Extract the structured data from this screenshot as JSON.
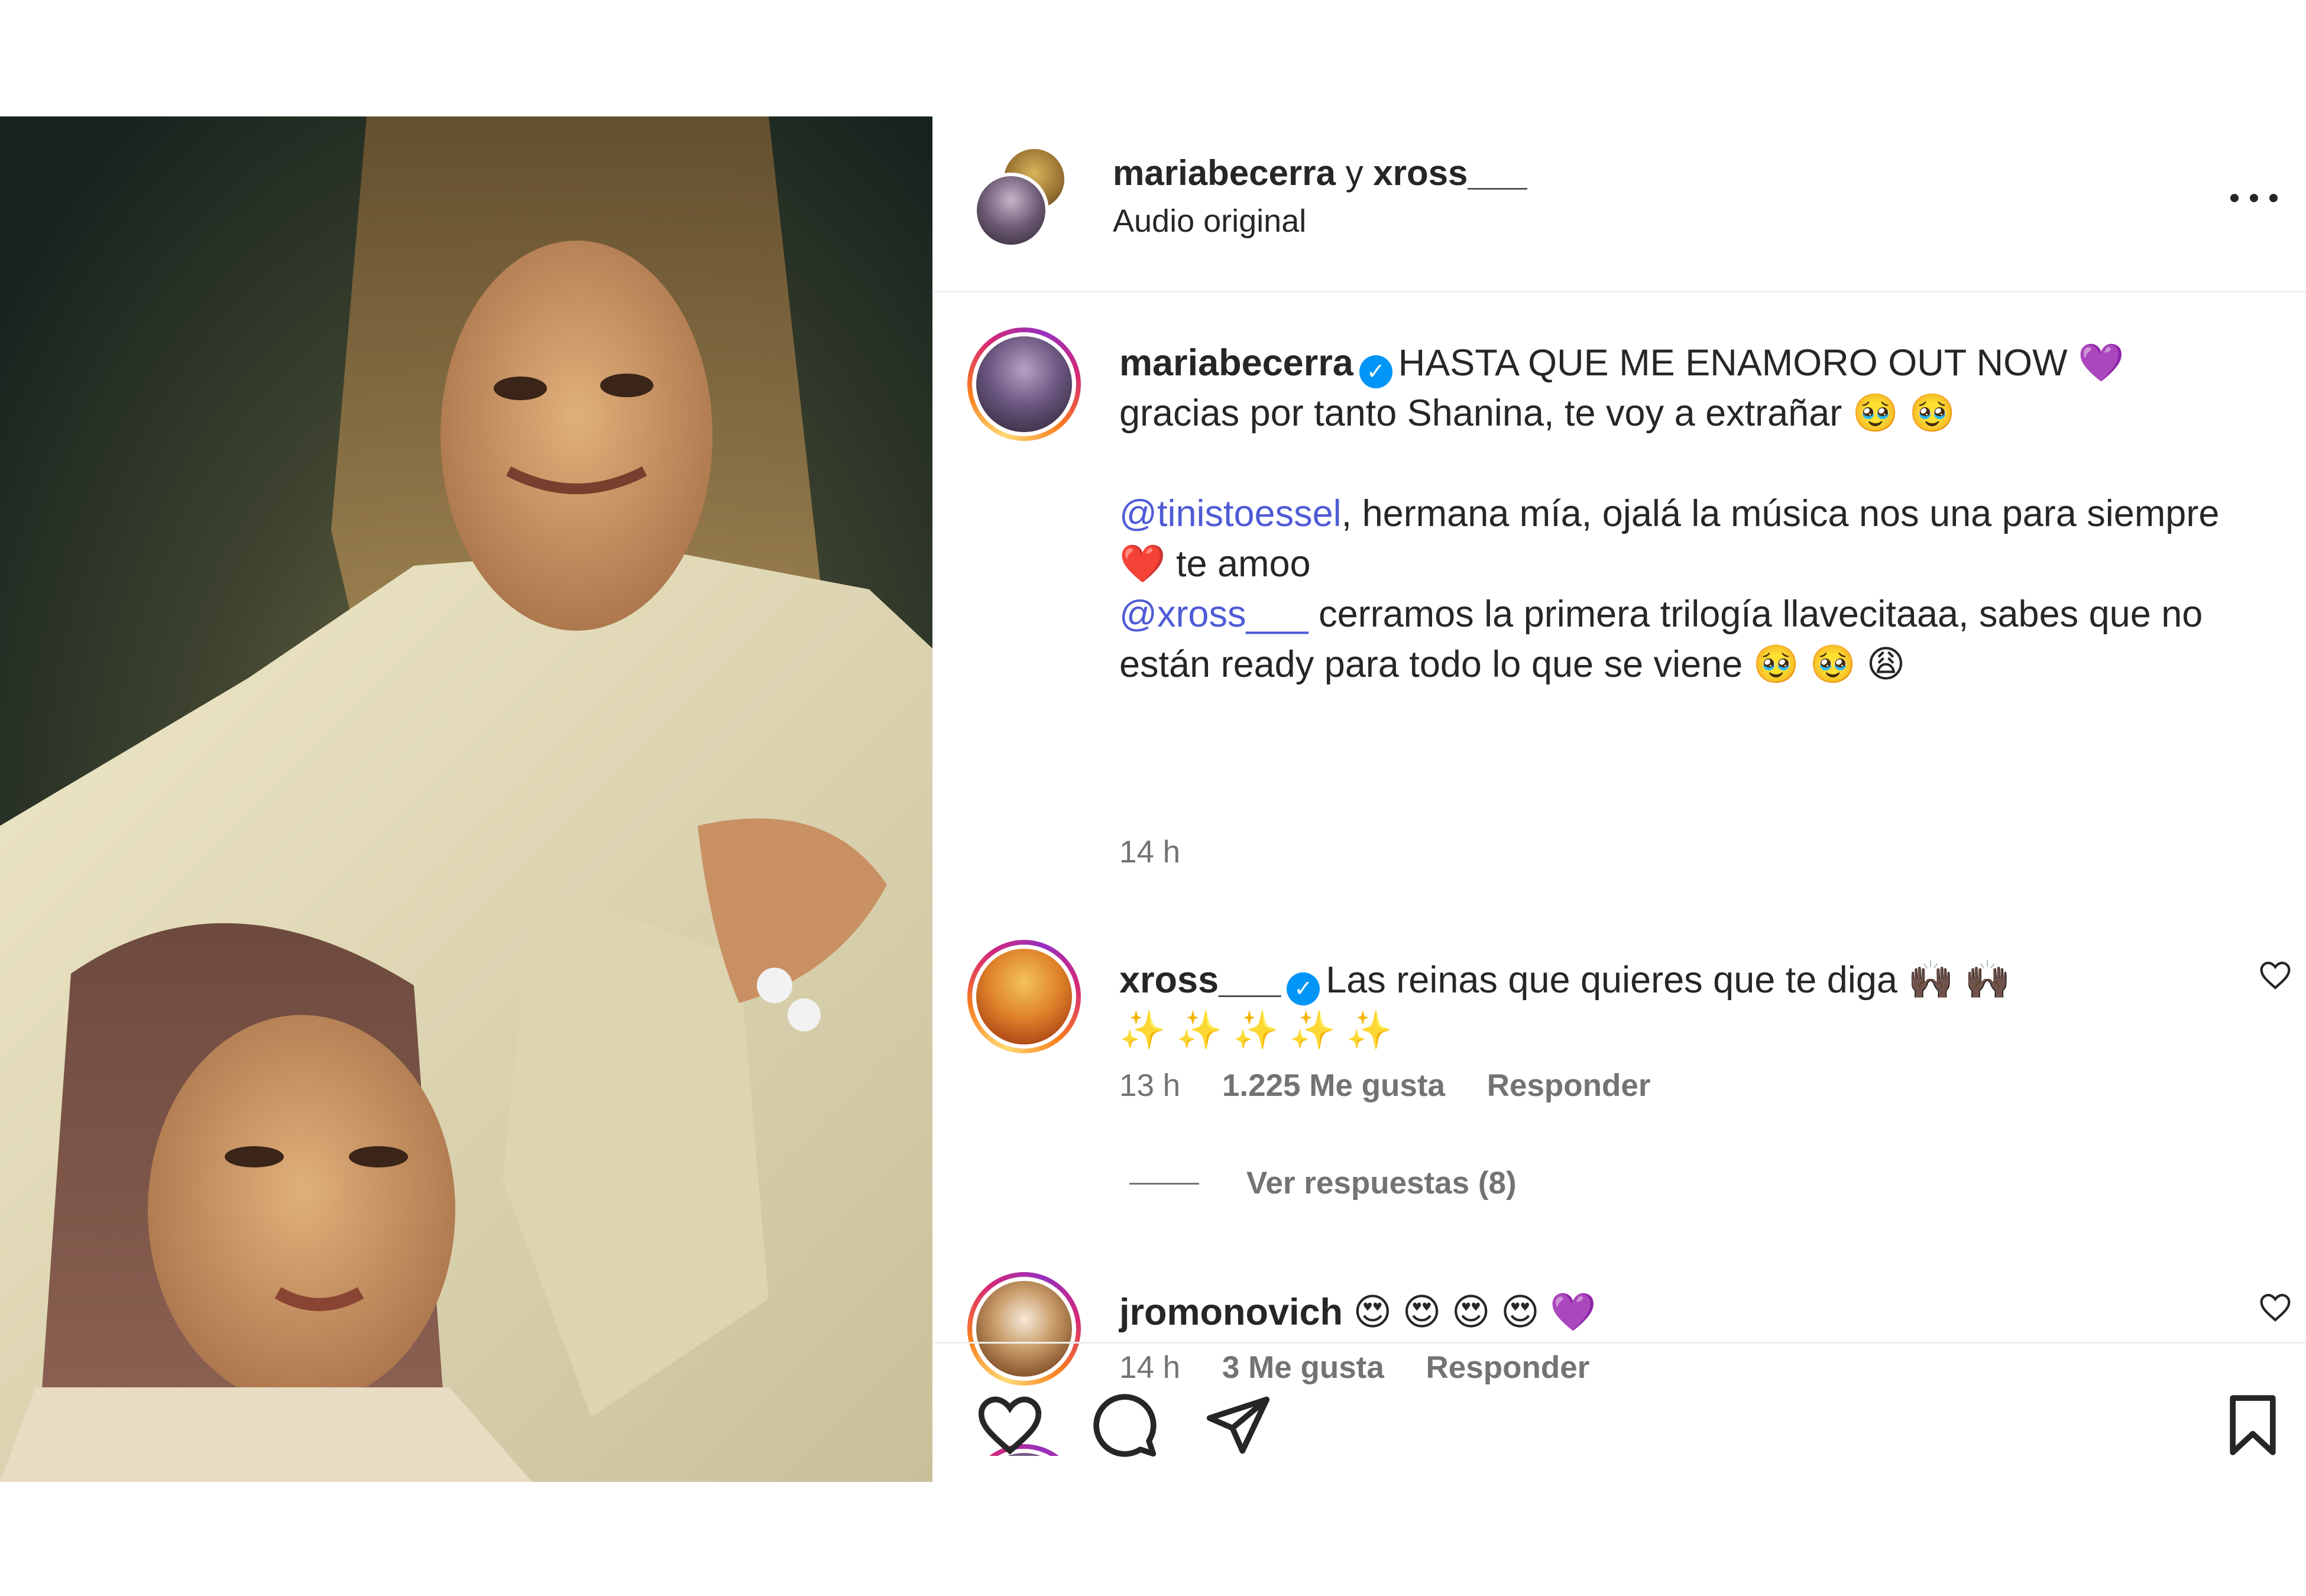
{
  "header": {
    "user1": "mariabecerra",
    "connector": "y",
    "user2": "xross___",
    "subtitle": "Audio original",
    "more_icon": "more-horizontal-icon"
  },
  "caption": {
    "username": "mariabecerra",
    "line1": "HASTA QUE ME ENAMORO OUT NOW 💜",
    "line2": "gracias por tanto Shanina, te voy a extrañar 🥹 🥹",
    "mention1": "@tinistoessel",
    "line3": ", hermana mía, ojalá la música nos una para siempre",
    "line4": "❤️  te amoo",
    "mention2": "@xross___",
    "line5": " cerramos la primera trilogía llavecitaaa, sabes que no",
    "line6": "están ready para todo lo que se viene 🥹 🥹 😩",
    "time": "14 h"
  },
  "comments": [
    {
      "username": "xross___",
      "verified": true,
      "text1": "Las reinas que quieres que te diga 🙌🏿 🙌🏿",
      "text2": "✨ ✨ ✨ ✨ ✨",
      "time": "13 h",
      "likes": "1.225 Me gusta",
      "reply": "Responder",
      "view_replies": "Ver respuestas (8)"
    },
    {
      "username": "jromonovich",
      "verified": false,
      "text1": "😍 😍 😍 😍 💜",
      "time": "14 h",
      "likes": "3 Me gusta",
      "reply": "Responder"
    }
  ],
  "actions": {
    "like_icon": "heart-icon",
    "comment_icon": "comment-icon",
    "share_icon": "send-icon",
    "save_icon": "bookmark-icon"
  },
  "colors": {
    "text": "#262626",
    "secondary": "#737373",
    "mention": "#4f5bd5",
    "verified": "#0095f6",
    "divider": "#efefef"
  }
}
